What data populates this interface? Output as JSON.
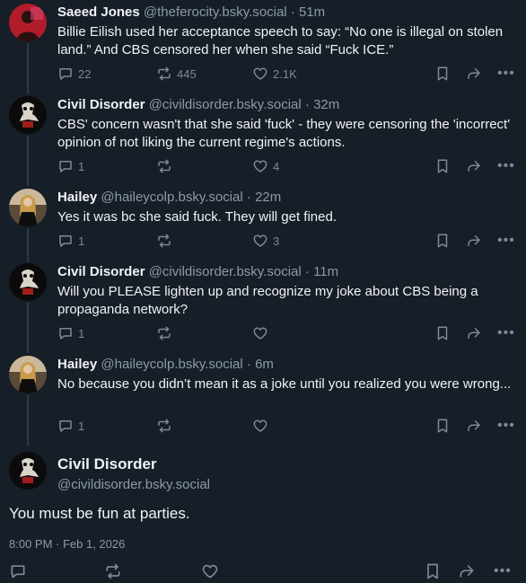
{
  "posts": [
    {
      "name": "Saeed Jones",
      "handle": "@theferocity.bsky.social",
      "time": "51m",
      "text": "Billie Eilish used her acceptance speech to say: “No one is illegal on stolen land.” And CBS censored her when she said “Fuck ICE.”",
      "replies": "22",
      "reposts": "445",
      "likes": "2.1K",
      "avatar_color": "#b01c2a"
    },
    {
      "name": "Civil Disorder",
      "handle": "@civildisorder.bsky.social",
      "time": "32m",
      "text": "CBS' concern wasn't that she said 'fuck' - they were censoring the 'incorrect' opinion of not liking the current regime's actions.",
      "replies": "1",
      "reposts": "",
      "likes": "4",
      "avatar_color": "#0b0b0b"
    },
    {
      "name": "Hailey",
      "handle": "@haileycolp.bsky.social",
      "time": "22m",
      "text": "Yes it was bc she said fuck. They will get fined.",
      "replies": "1",
      "reposts": "",
      "likes": "3",
      "avatar_color": "#3b2a20"
    },
    {
      "name": "Civil Disorder",
      "handle": "@civildisorder.bsky.social",
      "time": "11m",
      "text": "Will you PLEASE lighten up and recognize my joke about CBS being a propaganda network?",
      "replies": "1",
      "reposts": "",
      "likes": "",
      "avatar_color": "#0b0b0b"
    },
    {
      "name": "Hailey",
      "handle": "@haileycolp.bsky.social",
      "time": "6m",
      "text": "No because you didn’t mean it as a joke until you realized you were wrong...",
      "replies": "1",
      "reposts": "",
      "likes": "",
      "avatar_color": "#3b2a20"
    }
  ],
  "focus": {
    "name": "Civil Disorder",
    "handle": "@civildisorder.bsky.social",
    "text": "You must be fun at parties.",
    "timestamp": "8:00 PM · Feb 1, 2026"
  },
  "colors": {
    "background": "#161e27",
    "text": "#f1f3f5",
    "muted": "#8c9aab",
    "thread_line": "#2e3a48"
  }
}
